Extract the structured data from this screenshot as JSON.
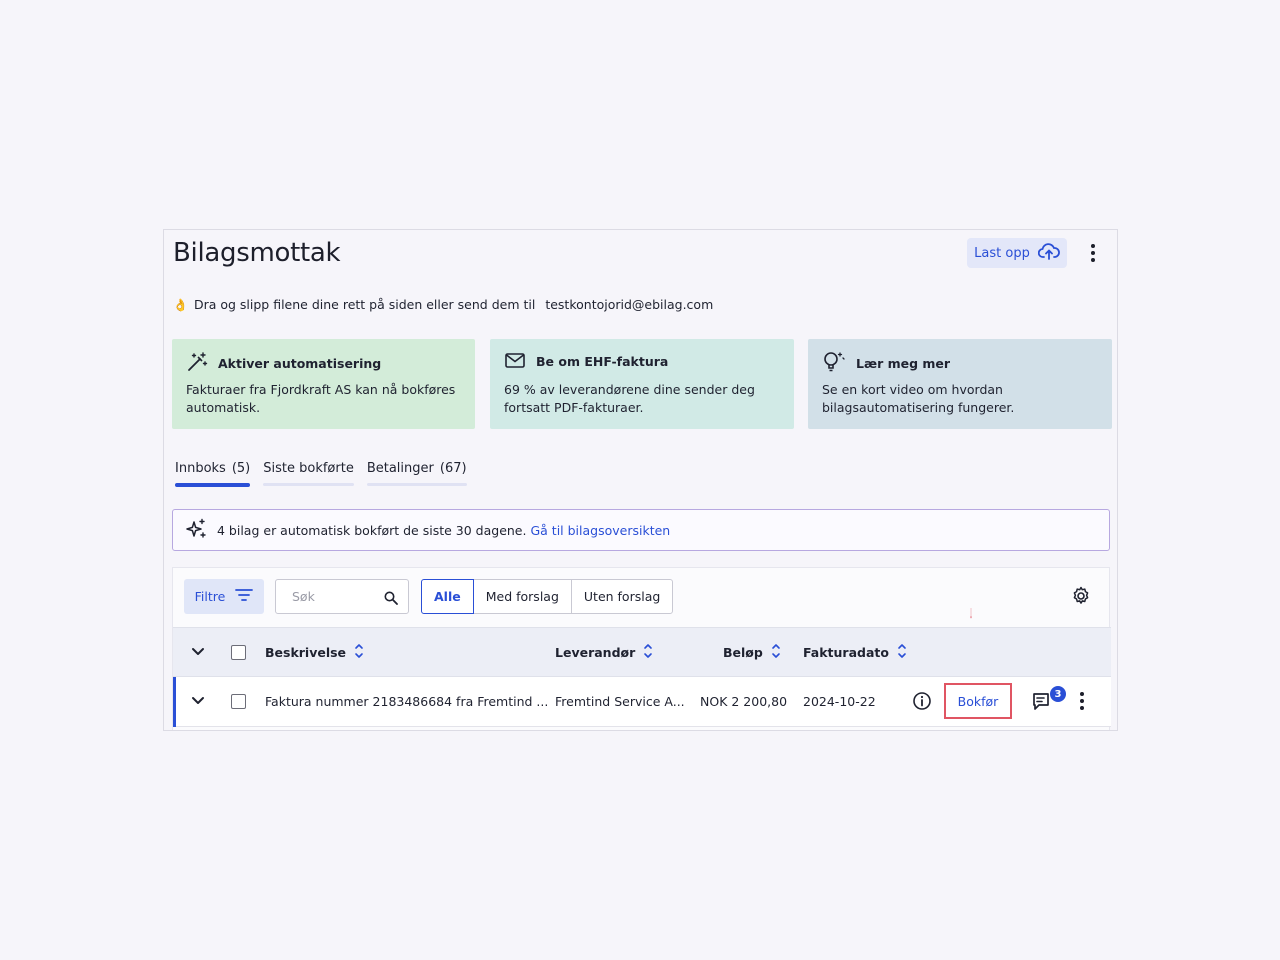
{
  "page": {
    "title": "Bilagsmottak",
    "upload_label": "Last opp",
    "hint_text": "Dra og slipp filene dine rett på siden eller send dem til",
    "hint_email": "testkontojorid@ebilag.com",
    "hint_emoji": "👌"
  },
  "cards": [
    {
      "title": "Aktiver automatisering",
      "body": "Fakturaer fra Fjordkraft AS kan nå bokføres automatisk.",
      "icon": "magic-wand-icon",
      "color": "#d3ecd9"
    },
    {
      "title": "Be om EHF-faktura",
      "body": "69 % av leverandørene dine sender deg fortsatt PDF-fakturaer.",
      "icon": "envelope-icon",
      "color": "#d1eae6"
    },
    {
      "title": "Lær meg mer",
      "body": "Se en kort video om hvordan bilagsautomatisering fungerer.",
      "icon": "lightbulb-icon",
      "color": "#d2e0e8"
    }
  ],
  "tabs": [
    {
      "label": "Innboks",
      "count": "(5)",
      "active": true
    },
    {
      "label": "Siste bokførte",
      "count": ""
    },
    {
      "label": "Betalinger",
      "count": "(67)"
    }
  ],
  "banner": {
    "text": "4 bilag er automatisk bokført de siste 30 dagene.",
    "link": "Gå til bilagsoversikten"
  },
  "toolbar": {
    "filter_label": "Filtre",
    "search_placeholder": "Søk",
    "segments": [
      "Alle",
      "Med forslag",
      "Uten forslag"
    ],
    "selected_segment": "Alle"
  },
  "table": {
    "columns": [
      "Beskrivelse",
      "Leverandør",
      "Beløp",
      "Fakturadato"
    ],
    "rows": [
      {
        "description": "Faktura nummer 2183486684 fra Fremtind ...",
        "supplier": "Fremtind Service A...",
        "amount": "NOK 2 200,80",
        "invoice_date": "2024-10-22",
        "action_label": "Bokfør",
        "comment_count": "3"
      }
    ]
  },
  "colors": {
    "accent": "#2a4fd6",
    "highlight": "#e05563"
  }
}
